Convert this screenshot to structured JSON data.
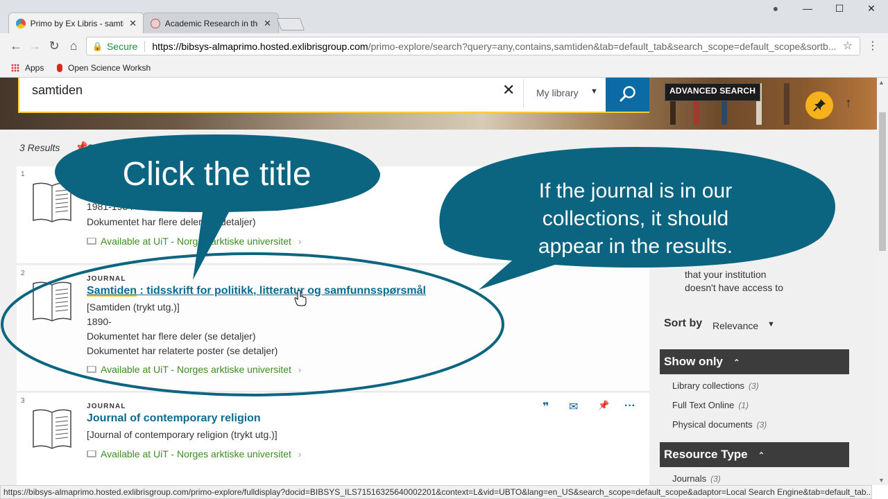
{
  "browser": {
    "tabs": [
      {
        "title": "Primo by Ex Libris - samti",
        "close": "✕",
        "active": true
      },
      {
        "title": "Academic Research in the",
        "close": "✕",
        "active": false
      }
    ],
    "window_controls": {
      "account": "●",
      "minimize": "—",
      "maximize": "☐",
      "close": "✕"
    },
    "nav": {
      "back": "←",
      "forward": "→",
      "reload": "↻",
      "home": "⌂"
    },
    "secure_label": "Secure",
    "url_host": "https://bibsys-almaprimo.hosted.exlibrisgroup.com",
    "url_path": "/primo-explore/search?query=any,contains,samtiden&tab=default_tab&search_scope=default_scope&sortb...",
    "bookmarks": [
      {
        "label": "Apps"
      },
      {
        "label": "Open Science Worksh"
      }
    ]
  },
  "search": {
    "query": "samtiden",
    "clear_symbol": "✕",
    "scope": "My library",
    "scope_caret": "▼",
    "advanced_label": "ADVANCED SEARCH",
    "up_arrow": "↑"
  },
  "results": {
    "count_label": "3 Results",
    "save_query_label": "Sa",
    "items": [
      {
        "rank": "1",
        "lines": [
          "1981-1984",
          "Dokumentet har flere deler (se detaljer)"
        ],
        "availability": "Available at UiT - Norges arktiske universitet"
      },
      {
        "rank": "2",
        "type": "JOURNAL",
        "title_highlight": "Samtiden",
        "title_rest": " : tidsskrift for politikk, litteratur og samfunnsspørsmål",
        "lines": [
          "[Samtiden (trykt utg.)]",
          "1890-",
          "Dokumentet har flere deler (se detaljer)",
          "Dokumentet har relaterte poster (se detaljer)"
        ],
        "availability": "Available at UiT - Norges arktiske universitet"
      },
      {
        "rank": "3",
        "type": "JOURNAL",
        "title": "Journal of contemporary religion",
        "lines": [
          "[Journal of contemporary religion (trykt utg.)]"
        ],
        "availability": "Available at UiT - Norges arktiske universitet",
        "actions": {
          "cite": "❞",
          "email": "✉",
          "pin": "📌",
          "more": "···"
        }
      }
    ],
    "chevron": "›"
  },
  "sidebar": {
    "partial_note_line1": "that your institution",
    "partial_note_line2": "doesn't have access to",
    "sort_label": "Sort by",
    "sort_value": "Relevance",
    "sort_caret": "▼",
    "facets": [
      {
        "title": "Show only",
        "items": [
          {
            "label": "Library collections",
            "count": "(3)"
          },
          {
            "label": "Full Text Online",
            "count": "(1)"
          },
          {
            "label": "Physical documents",
            "count": "(3)"
          }
        ]
      },
      {
        "title": "Resource Type",
        "items": [
          {
            "label": "Journals",
            "count": "(3)"
          }
        ]
      }
    ],
    "chevron_up": "⌃"
  },
  "status_bar": "https://bibsys-almaprimo.hosted.exlibrisgroup.com/primo-explore/fulldisplay?docid=BIBSYS_ILS71516325640002201&context=L&vid=UBTO&lang=en_US&search_scope=default_scope&adaptor=Local Search Engine&tab=default_tab...",
  "callouts": {
    "click_title": "Click the title",
    "journal_note_line1": "If the journal is in our",
    "journal_note_line2": "collections, it should",
    "journal_note_line3": "appear in the results."
  },
  "colors": {
    "callout_fill": "#0c6580",
    "primo_blue": "#0b6ba5",
    "highlight": "#ffcc33",
    "available_green": "#3a8d1e"
  }
}
